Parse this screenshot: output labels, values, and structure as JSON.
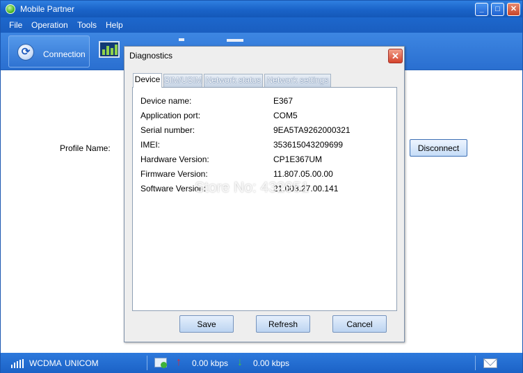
{
  "app": {
    "title": "Mobile Partner"
  },
  "window_controls": {
    "minimize": "_",
    "maximize": "□",
    "close": "✕"
  },
  "menu": [
    "File",
    "Operation",
    "Tools",
    "Help"
  ],
  "toolbar": {
    "connection_label": "Connection"
  },
  "main": {
    "profile_label": "Profile Name:",
    "disconnect_label": "Disconnect"
  },
  "dialog": {
    "title": "Diagnostics",
    "close_glyph": "✕",
    "tabs": [
      "Device",
      "SIM/USIM",
      "Network status",
      "Network settings"
    ],
    "active_tab": "Device",
    "device_info": [
      {
        "label": "Device name:",
        "value": "E367"
      },
      {
        "label": "Application port:",
        "value": "COM5"
      },
      {
        "label": "Serial number:",
        "value": "9EA5TA9262000321"
      },
      {
        "label": "IMEI:",
        "value": "353615043209699"
      },
      {
        "label": "Hardware Version:",
        "value": "CP1E367UM"
      },
      {
        "label": "Firmware Version:",
        "value": "11.807.05.00.00"
      },
      {
        "label": "Software Version:",
        "value": "21.003.27.00.141"
      }
    ],
    "watermark": "Store No: 432951",
    "buttons": {
      "save": "Save",
      "refresh": "Refresh",
      "cancel": "Cancel"
    }
  },
  "status": {
    "network_type": "WCDMA",
    "network_name": "UNICOM",
    "upload_rate": "0.00 kbps",
    "download_rate": "0.00 kbps",
    "up_arrow": "↑",
    "down_arrow": "↓"
  },
  "colors": {
    "title_blue": "#1a63c8",
    "dialog_bg": "#eeeeee",
    "close_red": "#d4432b",
    "upload_red": "#e8262b",
    "download_green": "#44c23a"
  },
  "icons": [
    "app-icon",
    "minimize-icon",
    "maximize-icon",
    "close-icon",
    "connection-icon",
    "statistics-icon",
    "signal-icon",
    "pc-status-icon",
    "upload-arrow-icon",
    "download-arrow-icon",
    "mail-icon"
  ]
}
